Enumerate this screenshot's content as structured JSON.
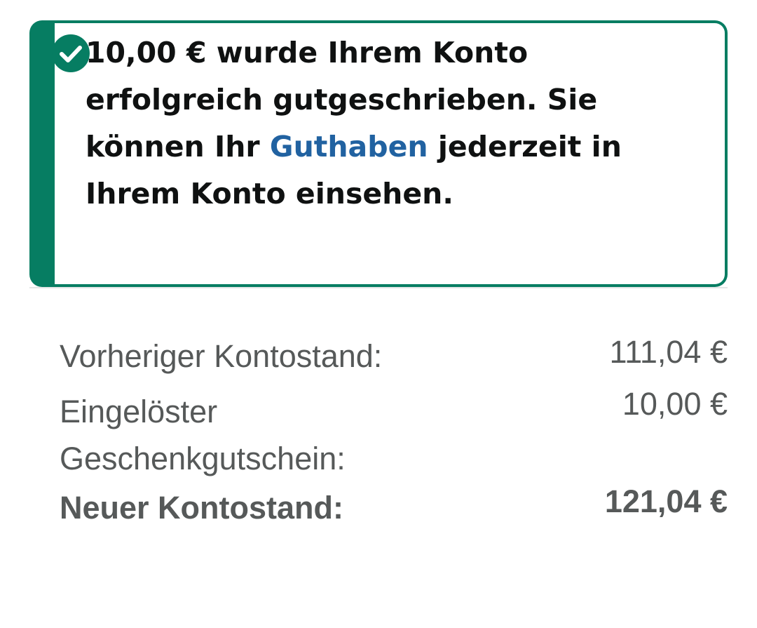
{
  "alert": {
    "icon": "check-circle-icon",
    "accent_color": "#067d62",
    "text_before_link": "10,00 € wurde Ihrem Konto erfolgreich gutgeschrieben. Sie können Ihr ",
    "link_text": "Guthaben",
    "link_color": "#2162a1",
    "text_after_link": " jederzeit in Ihrem Konto einsehen."
  },
  "summary": {
    "rows": [
      {
        "label": "Vorheriger Kontostand:",
        "value": "111,04 €"
      },
      {
        "label": "Eingelöster Geschenkgutschein:",
        "value": "10,00 €"
      },
      {
        "label": "Neuer Kontostand:",
        "value": "121,04 €"
      }
    ]
  }
}
